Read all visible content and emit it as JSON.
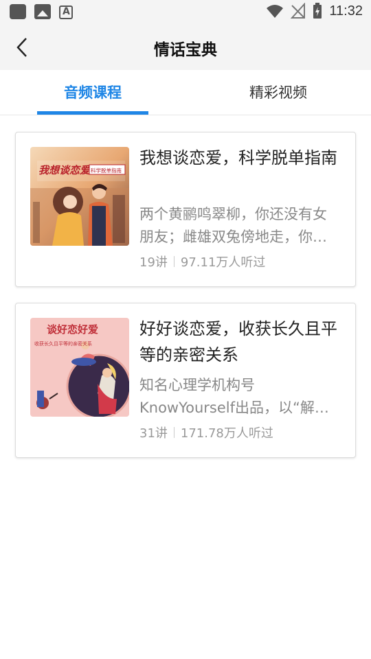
{
  "status_bar": {
    "time": "11:32",
    "left_icons": [
      "hand-icon",
      "photo-icon",
      "font-icon"
    ],
    "right_icons": [
      "wifi-icon",
      "no-signal-icon",
      "battery-charging-icon"
    ]
  },
  "header": {
    "title": "情话宝典",
    "back_icon": "chevron-left-icon"
  },
  "tabs": [
    {
      "label": "音频课程",
      "active": true
    },
    {
      "label": "精彩视频",
      "active": false
    }
  ],
  "courses": [
    {
      "title": "我想谈恋爱，科学脱单指南",
      "desc_line1": "两个黄鹂鸣翠柳，你还没有女",
      "desc_line2": "朋友；雌雄双兔傍地走，你…",
      "lessons": "19讲",
      "listeners": "97.11万人听过",
      "cover_text": "我想谈恋爱",
      "cover_subtext": "科学脱单指南"
    },
    {
      "title": "好好谈恋爱，收获长久且平等的亲密关系",
      "desc_line1": "知名心理学机构号",
      "desc_line2": "KnowYourself出品，以“解…",
      "lessons": "31讲",
      "listeners": "171.78万人听过",
      "cover_text": "谈好恋好爱",
      "cover_subtext": "收获长久且平等的亲密关系"
    }
  ],
  "colors": {
    "accent": "#1f86e6",
    "bar_bg": "#f4f4f4"
  }
}
